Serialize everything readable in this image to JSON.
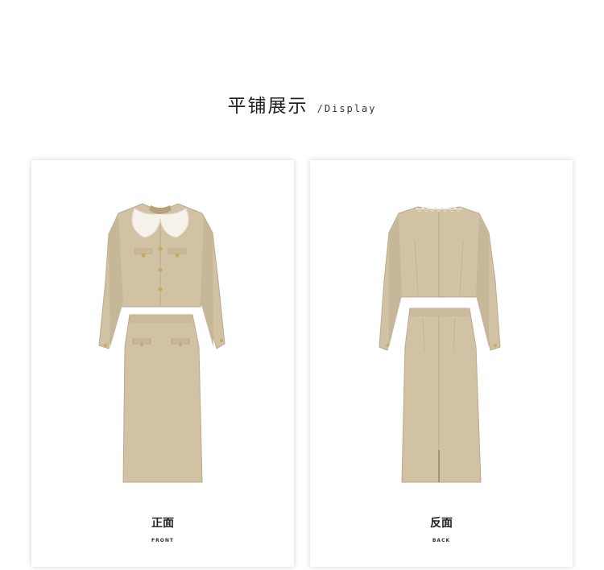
{
  "section": {
    "title_cn": "平铺展示",
    "title_en": "/Display"
  },
  "cards": [
    {
      "label_cn": "正面",
      "label_en": "FRONT"
    },
    {
      "label_cn": "反面",
      "label_en": "BACK"
    }
  ],
  "colors": {
    "fabric": "#d1c2a4",
    "fabric_shadow": "#b9aa8c",
    "collar": "#f6f2ea",
    "button": "#c9a86a"
  }
}
